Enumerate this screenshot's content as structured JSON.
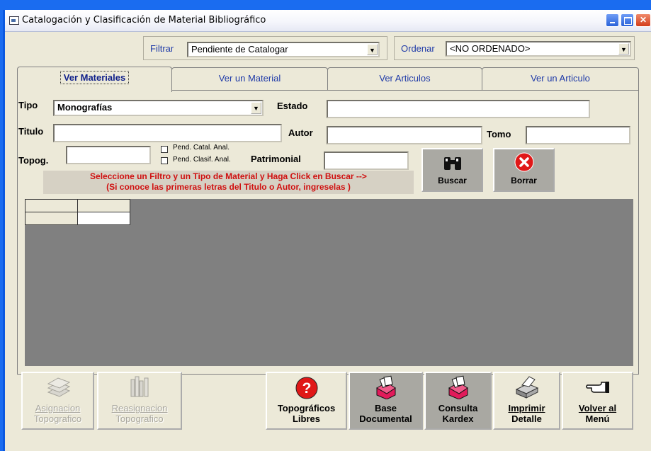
{
  "window": {
    "title": "Catalogación y Clasificación de Material Bibliográfico"
  },
  "filter": {
    "label": "Filtrar",
    "value": "Pendiente de Catalogar",
    "sort_label": "Ordenar",
    "sort_value": "<NO ORDENADO>"
  },
  "tabs": [
    {
      "label": "Ver Materiales",
      "active": true
    },
    {
      "label": "Ver un Material",
      "active": false
    },
    {
      "label": "Ver Articulos",
      "active": false
    },
    {
      "label": "Ver un Articulo",
      "active": false
    }
  ],
  "form": {
    "tipo_label": "Tipo",
    "tipo_value": "Monografías",
    "estado_label": "Estado",
    "estado_value": "",
    "titulo_label": "Titulo",
    "titulo_value": "",
    "autor_label": "Autor",
    "autor_value": "",
    "tomo_label": "Tomo",
    "tomo_value": "",
    "topog_label": "Topog.",
    "topog_value": "",
    "pend_catal_label": "Pend. Catal. Anal.",
    "pend_clasif_label": "Pend. Clasif. Anal.",
    "patrimonial_label": "Patrimonial",
    "patrimonial_value": ""
  },
  "hint": {
    "line1": "Seleccione un Filtro y un Tipo de Material y  Haga Click en Buscar      -->",
    "line2": "(Si conoce las primeras letras del Titulo o Autor, ingreselas )"
  },
  "actions": {
    "buscar": "Buscar",
    "borrar": "Borrar"
  },
  "bottom_buttons": {
    "asignacion_1": "Asignacion",
    "asignacion_2": "Topografico",
    "reasignacion_1": "Reasignacion",
    "reasignacion_2": "Topografico",
    "topograficos_1": "Topográficos",
    "topograficos_2": "Libres",
    "base_1": "Base",
    "base_2": "Documental",
    "kardex_1": "Consulta",
    "kardex_2": "Kardex",
    "imprimir_1": "Imprimir",
    "imprimir_2": "Detalle",
    "volver_1": "Volver al",
    "volver_2": "Menú"
  },
  "icons": {
    "window": "app-window-icon",
    "buscar": "binoculars-icon",
    "borrar": "red-x-icon",
    "asignacion": "books-stack-icon",
    "reasignacion": "books-shelf-icon",
    "topograficos": "question-icon",
    "base": "card-file-icon",
    "kardex": "card-file-icon",
    "imprimir": "printer-icon",
    "volver": "pointing-hand-icon"
  },
  "colors": {
    "desktop": "#1a6cf0",
    "window_bg": "#ece9d8",
    "grid_bg": "#808080",
    "hint_text": "#d01010",
    "label_blue": "#1f3aa8"
  }
}
